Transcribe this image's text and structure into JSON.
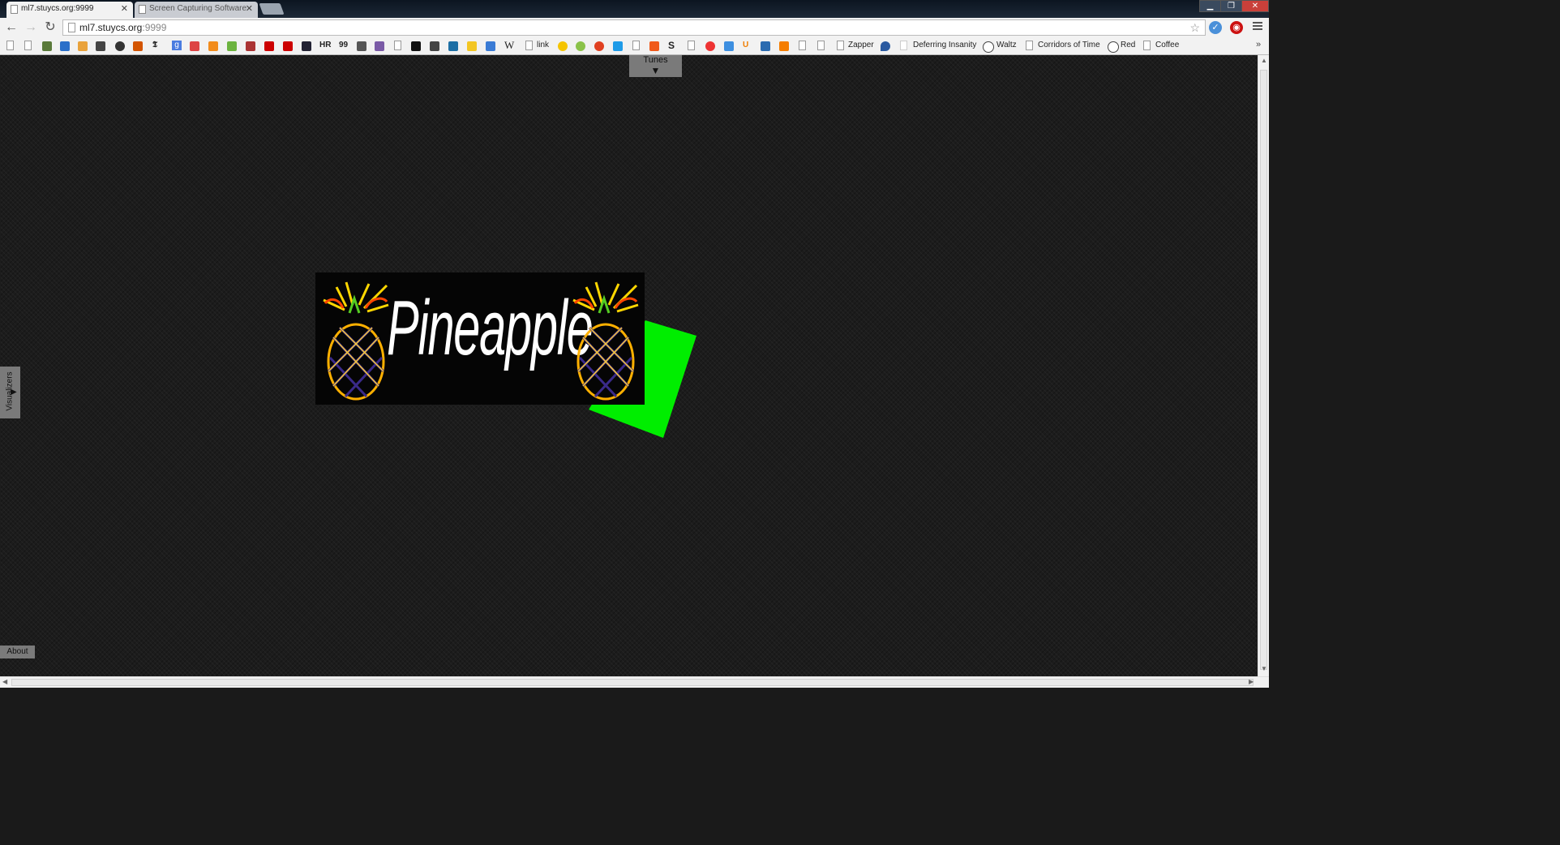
{
  "tabs": [
    {
      "title": "ml7.stuycs.org:9999",
      "active": true
    },
    {
      "title": "Screen Capturing Software",
      "active": false
    }
  ],
  "window_controls": [
    "minimize",
    "maximize",
    "close"
  ],
  "address_bar": {
    "host": "ml7.stuycs.org",
    "port": ":9999"
  },
  "bookmarks": {
    "items": [
      {
        "label": "link"
      },
      {
        "label": "Zapper"
      },
      {
        "label": "Deferring Insanity"
      },
      {
        "label": "Waltz"
      },
      {
        "label": "Corridors of Time"
      },
      {
        "label": "Red"
      },
      {
        "label": "Coffee"
      }
    ],
    "icon_letters": {
      "nyt": "𝕿",
      "google": "g",
      "wikipedia": "W",
      "s": "S",
      "quote": "99",
      "hr": "HR",
      "u": "U"
    }
  },
  "page": {
    "tunes_label": "Tunes",
    "visualizers_label": "Visualizers",
    "about_label": "About",
    "banner_text": "Pineapple"
  },
  "colors": {
    "green_shape": "#00ee00",
    "panel_gray": "#7a7a7a",
    "page_bg": "#1c1c1c"
  }
}
